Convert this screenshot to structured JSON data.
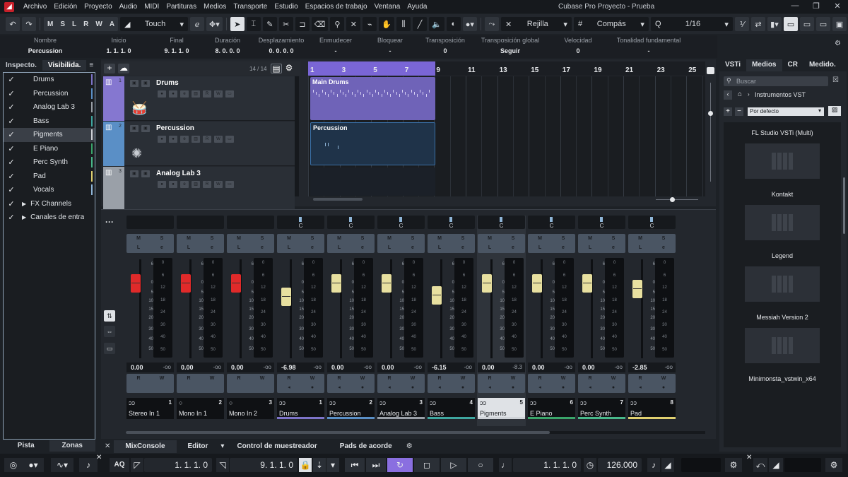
{
  "menu": [
    "Archivo",
    "Edición",
    "Proyecto",
    "Audio",
    "MIDI",
    "Partituras",
    "Medios",
    "Transporte",
    "Estudio",
    "Espacios de trabajo",
    "Ventana",
    "Ayuda"
  ],
  "window_title": "Cubase Pro Proyecto - Prueba",
  "window_controls": [
    "—",
    "❐",
    "✕"
  ],
  "toolbar": {
    "msl": [
      "M",
      "S",
      "L",
      "R",
      "W",
      "A"
    ],
    "automation_mode": "Touch",
    "snap_type": "Rejilla",
    "grid_type": "Compás",
    "quantize": "1/16"
  },
  "infoline": [
    {
      "label": "Nombre",
      "value": "Percussion"
    },
    {
      "label": "Inicio",
      "value": "1. 1. 1.  0"
    },
    {
      "label": "Final",
      "value": "9. 1. 1.  0"
    },
    {
      "label": "Duración",
      "value": "8. 0. 0.  0"
    },
    {
      "label": "Desplazamiento",
      "value": "0. 0. 0.  0"
    },
    {
      "label": "Enmudecer",
      "value": "-"
    },
    {
      "label": "Bloquear",
      "value": "-"
    },
    {
      "label": "Transposición",
      "value": "0"
    },
    {
      "label": "Transposición global",
      "value": "Seguir"
    },
    {
      "label": "Velocidad",
      "value": "0"
    },
    {
      "label": "Tonalidad fundamental",
      "value": "-"
    }
  ],
  "inspector": {
    "tabs": [
      "Inspecto.",
      "Visibilida."
    ],
    "menu_icon": "≡",
    "items": [
      {
        "name": "Drums",
        "color": "#7d74c9",
        "arrow": ""
      },
      {
        "name": "Percussion",
        "color": "#5a8fc6",
        "arrow": ""
      },
      {
        "name": "Analog Lab 3",
        "color": "#9aa0a8",
        "arrow": ""
      },
      {
        "name": "Bass",
        "color": "#3fa7a0",
        "arrow": ""
      },
      {
        "name": "Pigments",
        "color": "#cfd3d8",
        "arrow": ""
      },
      {
        "name": "E Piano",
        "color": "#3aa56a",
        "arrow": ""
      },
      {
        "name": "Perc Synth",
        "color": "#48b88a",
        "arrow": ""
      },
      {
        "name": "Pad",
        "color": "#e0d070",
        "arrow": ""
      },
      {
        "name": "Vocals",
        "color": "#8fb6d8",
        "arrow": ""
      },
      {
        "name": "FX Channels",
        "color": "",
        "arrow": "▶"
      },
      {
        "name": "Canales de entra",
        "color": "",
        "arrow": "▶"
      }
    ],
    "check": "✓",
    "bottom_tabs": [
      "Pista",
      "Zonas"
    ]
  },
  "project": {
    "track_count": "14 / 14",
    "tracks": [
      {
        "num": "1",
        "name": "Drums",
        "color": "#8577d0"
      },
      {
        "num": "2",
        "name": "Percussion",
        "color": "#5a8fc6"
      },
      {
        "num": "3",
        "name": "Analog Lab 3",
        "color": "#9aa0a8"
      }
    ],
    "ruler": [
      "1",
      "3",
      "5",
      "7",
      "9",
      "11",
      "13",
      "15",
      "17",
      "19",
      "21",
      "23",
      "25"
    ],
    "events": [
      {
        "name": "Main Drums",
        "color": "#6f63b8"
      },
      {
        "name": "Percussion",
        "color": "#1f3349"
      }
    ]
  },
  "mixer": {
    "strips": [
      {
        "name": "Stereo In 1",
        "idx": "1",
        "vol": "0.00",
        "peak": "-oo",
        "cap": "#e02a2a",
        "bar": "",
        "pan": false,
        "sel": false
      },
      {
        "name": "Mono In 1",
        "idx": "2",
        "vol": "0.00",
        "peak": "-oo",
        "cap": "#e02a2a",
        "bar": "",
        "pan": false,
        "sel": false
      },
      {
        "name": "Mono In 2",
        "idx": "3",
        "vol": "0.00",
        "peak": "-oo",
        "cap": "#e02a2a",
        "bar": "",
        "pan": false,
        "sel": false
      },
      {
        "name": "Drums",
        "idx": "1",
        "vol": "-6.98",
        "peak": "-oo",
        "cap": "#e8e0a0",
        "bar": "#7d74c9",
        "pan": true,
        "sel": false
      },
      {
        "name": "Percussion",
        "idx": "2",
        "vol": "0.00",
        "peak": "-oo",
        "cap": "#e8e0a0",
        "bar": "#5a8fc6",
        "pan": true,
        "sel": false
      },
      {
        "name": "Analog Lab 3",
        "idx": "3",
        "vol": "0.00",
        "peak": "-oo",
        "cap": "#e8e0a0",
        "bar": "#9aa0a8",
        "pan": true,
        "sel": false
      },
      {
        "name": "Bass",
        "idx": "4",
        "vol": "-6.15",
        "peak": "-oo",
        "cap": "#e8e0a0",
        "bar": "#3fa7a0",
        "pan": true,
        "sel": false
      },
      {
        "name": "Pigments",
        "idx": "5",
        "vol": "0.00",
        "peak": "-8.3",
        "cap": "#e8e0a0",
        "bar": "#cfd3d8",
        "pan": true,
        "sel": true
      },
      {
        "name": "E Piano",
        "idx": "6",
        "vol": "0.00",
        "peak": "-oo",
        "cap": "#e8e0a0",
        "bar": "#3aa56a",
        "pan": true,
        "sel": false
      },
      {
        "name": "Perc Synth",
        "idx": "7",
        "vol": "0.00",
        "peak": "-oo",
        "cap": "#e8e0a0",
        "bar": "#48b88a",
        "pan": true,
        "sel": false
      },
      {
        "name": "Pad",
        "idx": "8",
        "vol": "-2.85",
        "peak": "-oo",
        "cap": "#e8e0a0",
        "bar": "#e0d070",
        "pan": true,
        "sel": false
      }
    ],
    "fader_scale": [
      "6",
      "0",
      "5",
      "10",
      "15",
      "20",
      "30",
      "40",
      "50"
    ],
    "meter_scale": [
      "0",
      "6",
      "12",
      "18",
      "24",
      "30",
      "40",
      "50"
    ],
    "pan_label": "C",
    "mute": "M",
    "solo": "S",
    "listen": "L",
    "edit": "e",
    "read": "R",
    "write": "W"
  },
  "lower_tabs": [
    "MixConsole",
    "Editor",
    "Control de muestreador",
    "Pads de acorde"
  ],
  "rightzone": {
    "tabs": [
      "VSTi",
      "Medios",
      "CR",
      "Medido."
    ],
    "search_placeholder": "Buscar",
    "path": "Instrumentos VST",
    "filter": "Por defecto",
    "plugins": [
      "FL Studio VSTi (Multi)",
      "Kontakt",
      "Legend",
      "Messiah Version 2",
      "Minimonsta_vstwin_x64"
    ]
  },
  "transport": {
    "aq": "AQ",
    "left_locator": "1. 1. 1.   0",
    "right_locator": "9. 1. 1.   0",
    "position": "1. 1. 1.   0",
    "tempo": "126.000"
  }
}
